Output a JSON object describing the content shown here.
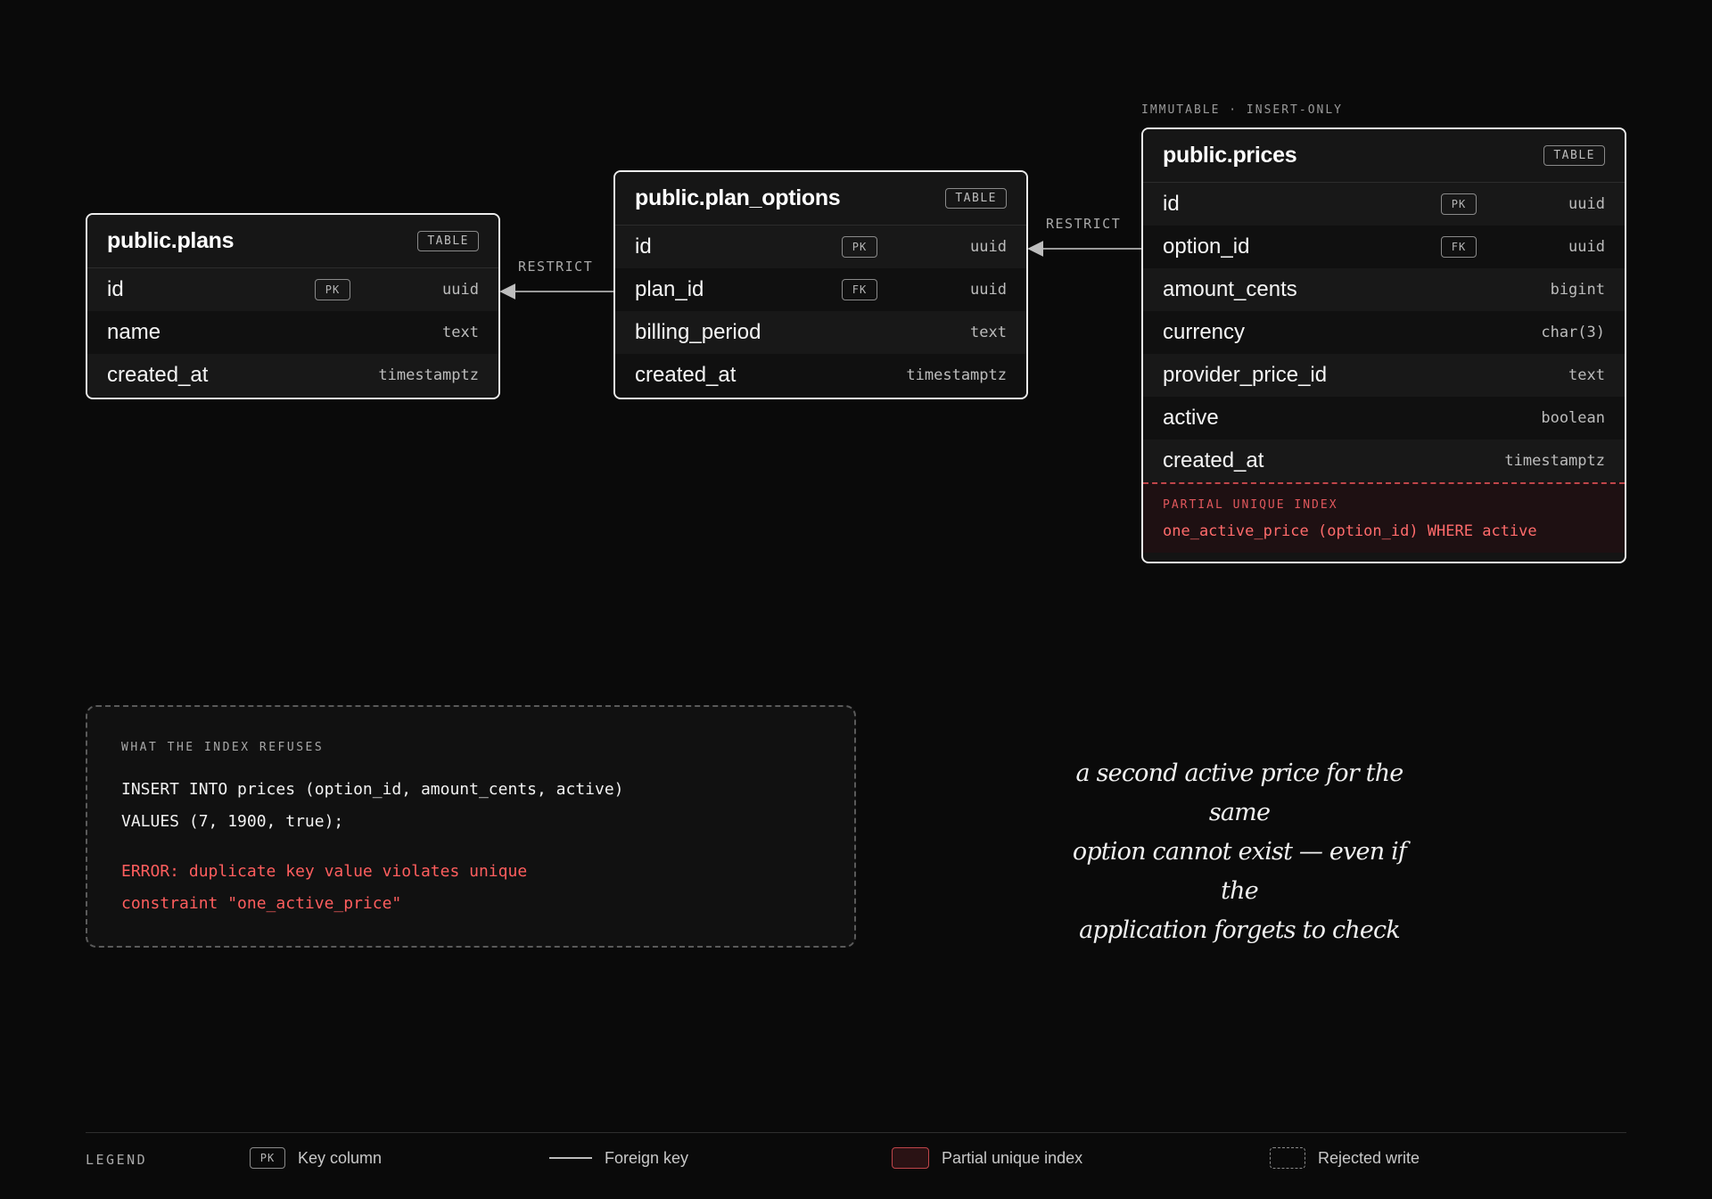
{
  "tables": {
    "plans": {
      "title": "public.plans",
      "badge": "TABLE",
      "columns": [
        {
          "name": "id",
          "key": "PK",
          "type": "uuid"
        },
        {
          "name": "name",
          "key": "",
          "type": "text"
        },
        {
          "name": "created_at",
          "key": "",
          "type": "timestamptz"
        }
      ]
    },
    "plan_options": {
      "title": "public.plan_options",
      "badge": "TABLE",
      "columns": [
        {
          "name": "id",
          "key": "PK",
          "type": "uuid"
        },
        {
          "name": "plan_id",
          "key": "FK",
          "type": "uuid"
        },
        {
          "name": "billing_period",
          "key": "",
          "type": "text"
        },
        {
          "name": "created_at",
          "key": "",
          "type": "timestamptz"
        }
      ]
    },
    "prices": {
      "title": "public.prices",
      "badge": "TABLE",
      "above_label": "IMMUTABLE · INSERT-ONLY",
      "columns": [
        {
          "name": "id",
          "key": "PK",
          "type": "uuid"
        },
        {
          "name": "option_id",
          "key": "FK",
          "type": "uuid"
        },
        {
          "name": "amount_cents",
          "key": "",
          "type": "bigint"
        },
        {
          "name": "currency",
          "key": "",
          "type": "char(3)"
        },
        {
          "name": "provider_price_id",
          "key": "",
          "type": "text"
        },
        {
          "name": "active",
          "key": "",
          "type": "boolean"
        },
        {
          "name": "created_at",
          "key": "",
          "type": "timestamptz"
        }
      ],
      "index": {
        "label": "PARTIAL UNIQUE INDEX",
        "definition": "one_active_price (option_id) WHERE active"
      }
    }
  },
  "relations": {
    "options_to_plans": "RESTRICT",
    "prices_to_options": "RESTRICT"
  },
  "refused": {
    "label": "WHAT THE INDEX REFUSES",
    "code": [
      "INSERT INTO prices (option_id, amount_cents, active)",
      "VALUES (7, 1900, true);"
    ],
    "error": [
      "ERROR: duplicate key value violates unique",
      "constraint \"one_active_price\""
    ]
  },
  "annotation": {
    "lines": [
      "a second active price for the same",
      "option cannot exist — even if the",
      "application forgets to check"
    ]
  },
  "legend": {
    "title": "LEGEND",
    "pk_badge": "PK",
    "key_column": "Key column",
    "foreign_key": "Foreign key",
    "partial_index": "Partial unique index",
    "rejected_write": "Rejected write"
  },
  "colors": {
    "background": "#0a0a0a",
    "card": "#141414",
    "accent_red": "#ff5e5e",
    "border": "#ededed"
  }
}
